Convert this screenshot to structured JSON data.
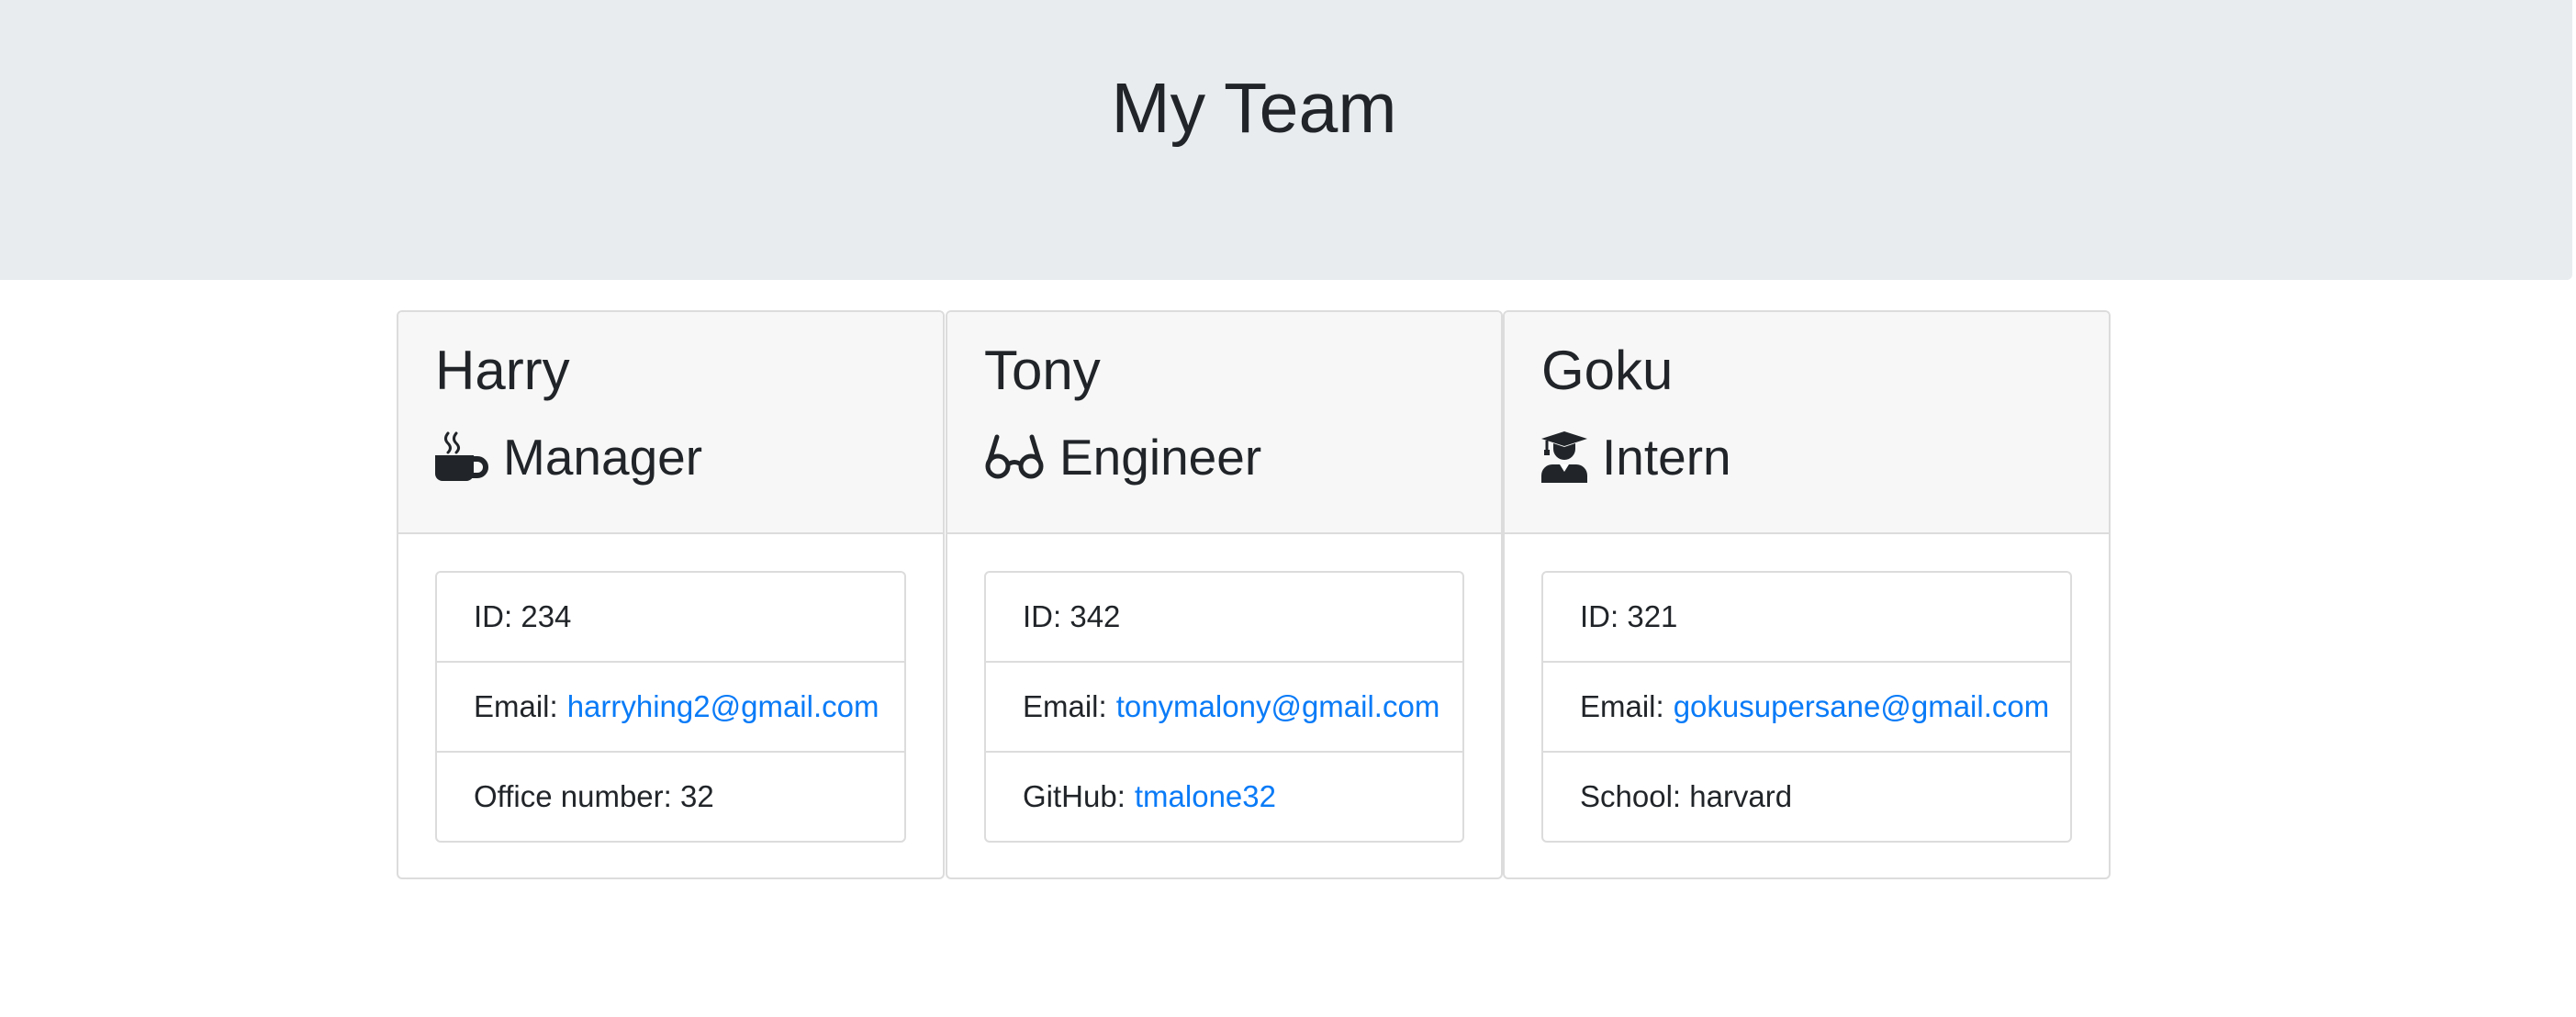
{
  "header": {
    "title": "My Team"
  },
  "colors": {
    "jumbotron_bg": "#e9ecef",
    "card_header_bg": "#f7f7f7",
    "link": "#0a7bf7",
    "text": "#212529"
  },
  "team": [
    {
      "name": "Harry",
      "role": "Manager",
      "icon": "coffee-mug-icon",
      "id_label": "ID: 234",
      "email_label": "Email:",
      "email": "harryhing2@gmail.com",
      "extra_label": "Office number: 32",
      "extra_link": ""
    },
    {
      "name": "Tony",
      "role": "Engineer",
      "icon": "glasses-icon",
      "id_label": "ID: 342",
      "email_label": "Email:",
      "email": "tonymalony@gmail.com",
      "extra_label": "GitHub:",
      "extra_link": "tmalone32"
    },
    {
      "name": "Goku",
      "role": "Intern",
      "icon": "graduate-icon",
      "id_label": "ID: 321",
      "email_label": "Email:",
      "email": "gokusupersane@gmail.com",
      "extra_label": "School: harvard",
      "extra_link": ""
    }
  ]
}
